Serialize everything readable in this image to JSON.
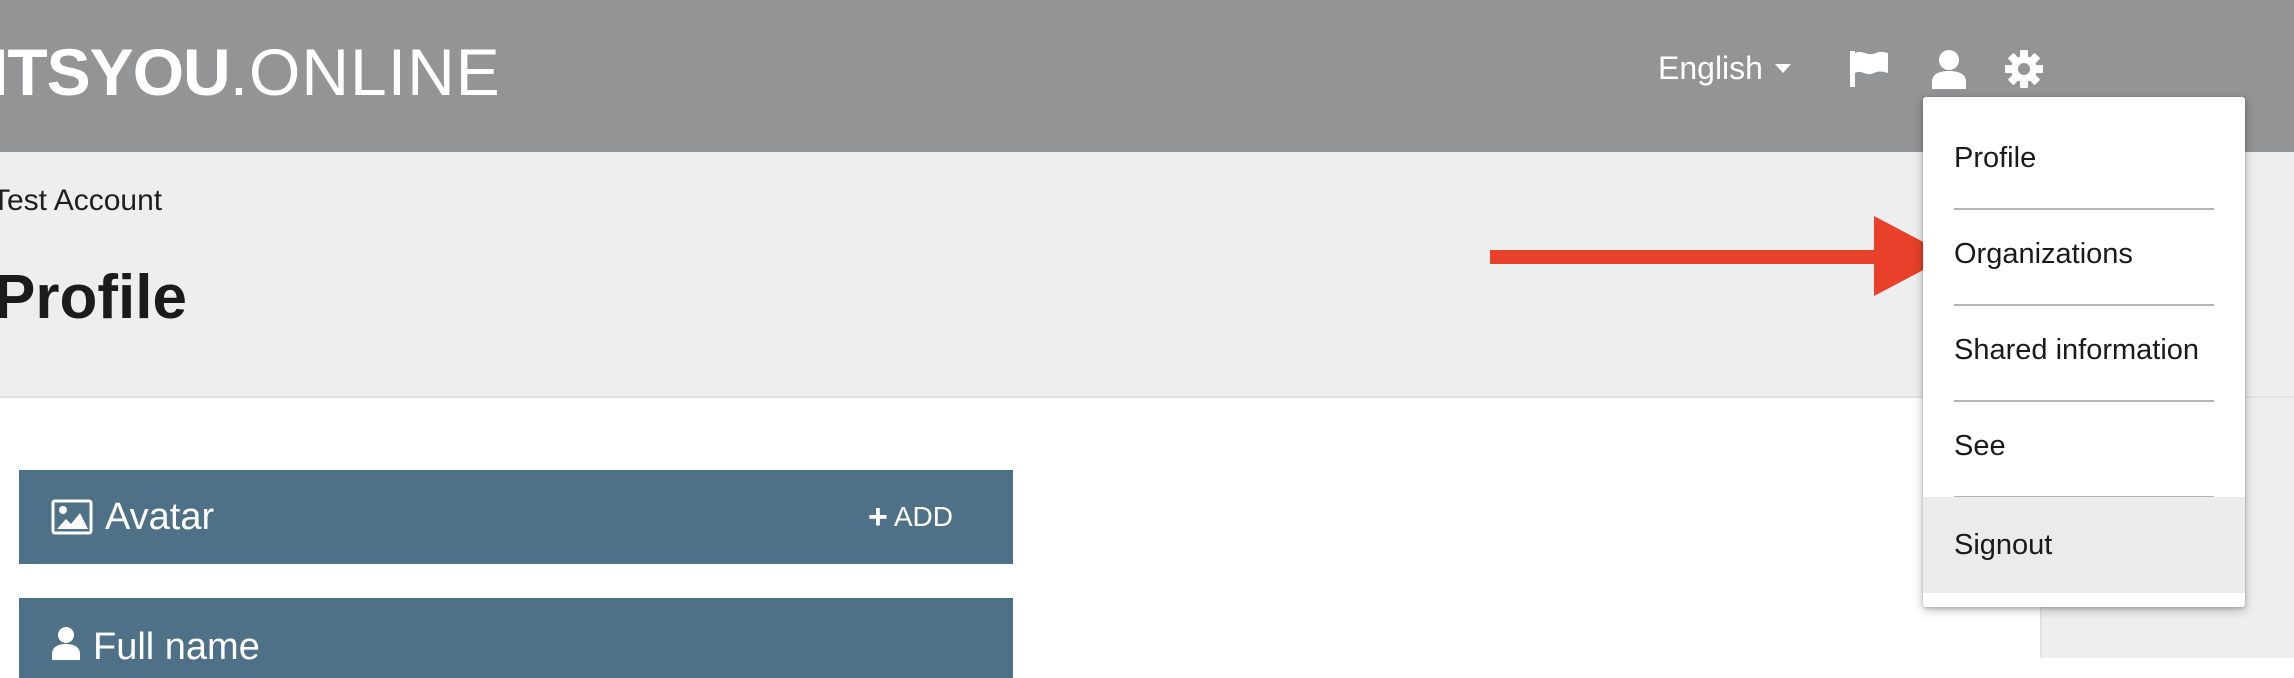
{
  "header": {
    "logo_bold": "ITSYOU",
    "logo_light": ".ONLINE",
    "language": "English"
  },
  "breadcrumb": "Test Account",
  "page_title": "Profile",
  "sections": {
    "avatar": {
      "title": "Avatar",
      "add_label": "ADD"
    },
    "fullname": {
      "title": "Full name"
    }
  },
  "menu": {
    "items": [
      {
        "label": "Profile"
      },
      {
        "label": "Organizations"
      },
      {
        "label": "Shared information"
      },
      {
        "label": "See"
      },
      {
        "label": "Signout"
      }
    ]
  },
  "colors": {
    "topbar": "#939496",
    "band": "#eeeeee",
    "card": "#4e7188",
    "arrow": "#e8402a"
  }
}
